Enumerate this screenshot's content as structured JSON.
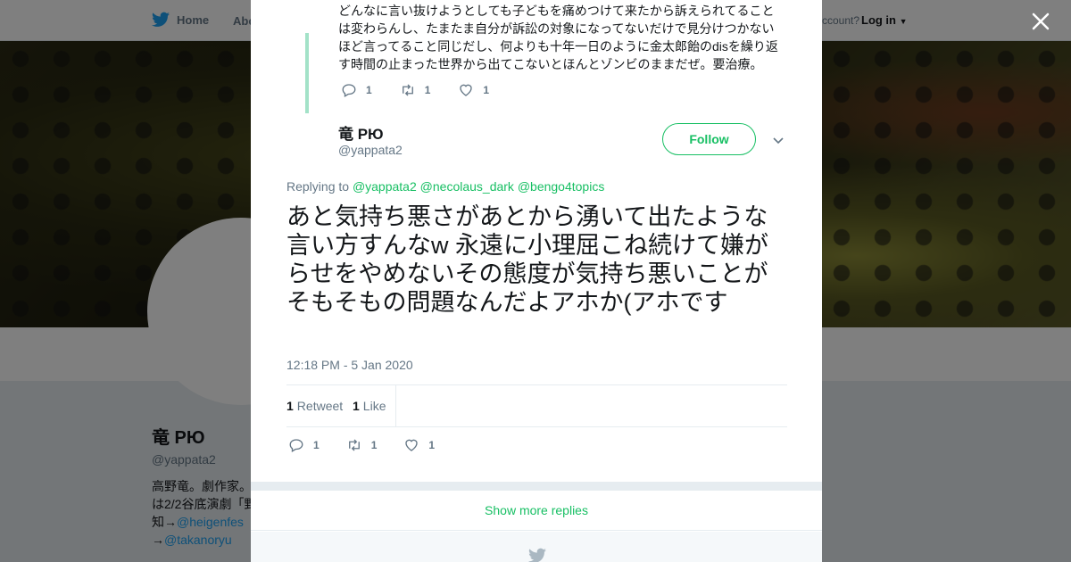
{
  "nav": {
    "home_label": "Home",
    "about_label": "Abo",
    "account_text": "ccount?",
    "login_label": "Log in"
  },
  "profile": {
    "name": "竜 РЮ",
    "handle": "@yappata2",
    "bio_line1": "高野竜。劇作家。",
    "bio_line2": "は2/2谷底演劇「野",
    "bio_line3_prefix": "知→",
    "bio_link1": "@heigenfes",
    "bio_line4_prefix": "→",
    "bio_link2": "@takanoryu"
  },
  "context_tweet": {
    "text": "どんなに言い抜けようとしても子どもを痛めつけて来たから訴えられてることは変わらんし、たまたま自分が訴訟の対象になってないだけで見分けつかないほど言ってること同じだし、何よりも十年一日のように金太郎飴のdisを繰り返す時間の止まった世界から出てこないとほんとゾンビのままだぜ。要治療。",
    "reply_count": "1",
    "retweet_count": "1",
    "like_count": "1"
  },
  "tweet": {
    "author_name": "竜 РЮ",
    "author_handle": "@yappata2",
    "follow_label": "Follow",
    "replying_to_label": "Replying to",
    "mentions": [
      "@yappata2",
      "@necolaus_dark",
      "@bengo4topics"
    ],
    "text": "あと気持ち悪さがあとから湧いて出たような言い方すんなw 永遠に小理屈こね続けて嫌がらせをやめないその態度が気持ち悪いことがそもそもの問題なんだよアホか(アホです",
    "timestamp": "12:18 PM - 5 Jan 2020",
    "retweets_num": "1",
    "retweets_label": "Retweet",
    "likes_num": "1",
    "likes_label": "Like",
    "reply_count": "1",
    "retweet_count": "1",
    "like_count": "1"
  },
  "show_more_label": "Show more replies",
  "colors": {
    "accent": "#17bf63",
    "thread_line": "#a3e2c8",
    "muted": "#657786",
    "twitter_blue": "#1da1f2"
  }
}
